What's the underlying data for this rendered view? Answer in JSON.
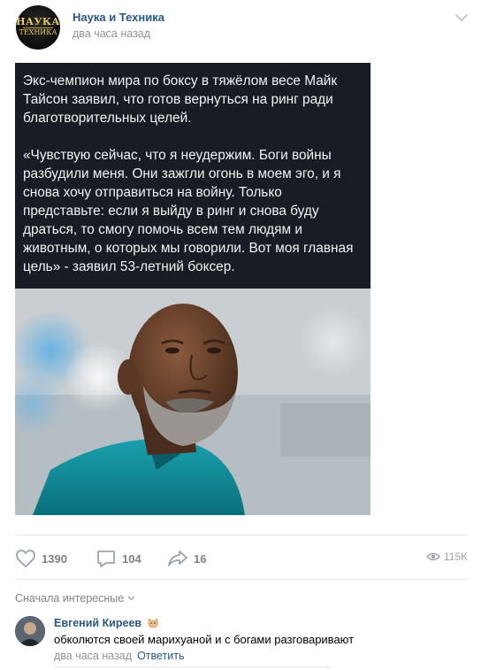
{
  "header": {
    "group_name": "Наука и Техника",
    "time": "два часа назад",
    "avatar_text_top": "НАУКА",
    "avatar_text_bottom": "ТЕХНИКА"
  },
  "post": {
    "paragraph1": "Экс-чемпион мира по боксу в тяжёлом весе Майк Тайсон заявил, что готов вернуться на ринг ради благотворительных целей.",
    "paragraph2": "«Чувствую сейчас, что я неудержим. Боги войны разбудили меня. Они зажгли огонь в моем эго, и я снова хочу отправиться на войну. Только представьте: если я выйду в ринг и снова буду драться, то смогу помочь всем тем людям и животным, о которых мы говорили. Вот моя главная цель» - заявил 53-летний боксер."
  },
  "actions": {
    "likes": "1390",
    "comments": "104",
    "shares": "16",
    "views": "115K"
  },
  "comments": {
    "sort_label": "Сначала интересные",
    "items": [
      {
        "author": "Евгений Киреев",
        "text": "обколются своей марихуаной и с богами разговаривают",
        "time": "два часа назад",
        "reply_label": "Ответить"
      }
    ]
  },
  "colors": {
    "link": "#2a5885",
    "muted": "#939393",
    "card_bg": "#181c25",
    "accent_gold": "#e8c76a"
  }
}
